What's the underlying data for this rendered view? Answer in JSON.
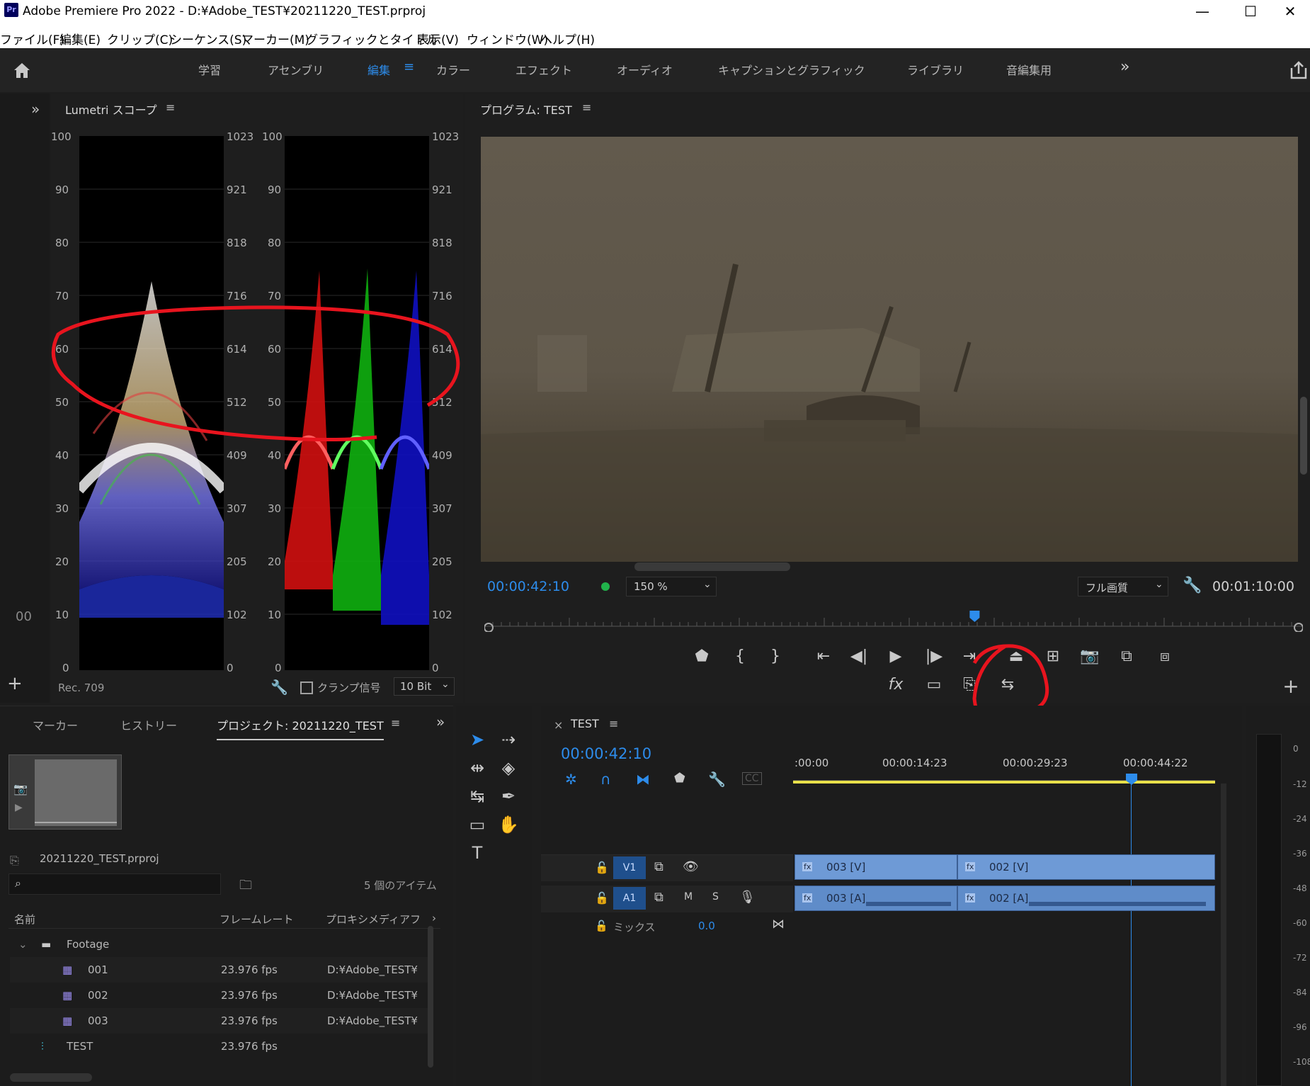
{
  "window": {
    "app_icon": "Pr",
    "title": "Adobe Premiere Pro 2022 - D:¥Adobe_TEST¥20211220_TEST.prproj",
    "minimize": "—",
    "maximize": "☐",
    "close": "✕"
  },
  "menu": [
    "ファイル(F)",
    "編集(E)",
    "クリップ(C)",
    "シーケンス(S)",
    "マーカー(M)",
    "グラフィックとタイトル",
    "表示(V)",
    "ウィンドウ(W)",
    "ヘルプ(H)"
  ],
  "workspaces": [
    "学習",
    "アセンブリ",
    "編集",
    "カラー",
    "エフェクト",
    "オーディオ",
    "キャプションとグラフィック",
    "ライブラリ",
    "音編集用"
  ],
  "workspace_active": "編集",
  "workspace_more": "»",
  "scope": {
    "title": "Lumetri スコープ",
    "left_scale": [
      "100",
      "90",
      "80",
      "70",
      "60",
      "50",
      "40",
      "30",
      "20",
      "10",
      "0"
    ],
    "right_scale": [
      "1023",
      "921",
      "818",
      "716",
      "614",
      "512",
      "409",
      "307",
      "205",
      "102",
      "0"
    ],
    "colorspace": "Rec. 709",
    "clamp_label": "クランプ信号",
    "bit_depth": "10 Bit",
    "side_label": "00"
  },
  "program": {
    "title": "プログラム: TEST",
    "timecode": "00:00:42:10",
    "zoom": "150 %",
    "quality": "フル画質",
    "duration": "00:01:10:00",
    "playhead_fraction": 0.6
  },
  "project": {
    "tabs": [
      "マーカー",
      "ヒストリー",
      "プロジェクト: 20211220_TEST"
    ],
    "active_tab": "プロジェクト: 20211220_TEST",
    "file": "20211220_TEST.prproj",
    "item_count": "5 個のアイテム",
    "columns": [
      "名前",
      "フレームレート",
      "プロキシメディアフ"
    ],
    "rows": [
      {
        "name": "Footage",
        "fps": "",
        "path": "",
        "type": "folder"
      },
      {
        "name": "001",
        "fps": "23.976 fps",
        "path": "D:¥Adobe_TEST¥",
        "type": "clip"
      },
      {
        "name": "002",
        "fps": "23.976 fps",
        "path": "D:¥Adobe_TEST¥",
        "type": "clip"
      },
      {
        "name": "003",
        "fps": "23.976 fps",
        "path": "D:¥Adobe_TEST¥",
        "type": "clip"
      },
      {
        "name": "TEST",
        "fps": "23.976 fps",
        "path": "",
        "type": "sequence"
      }
    ]
  },
  "timeline": {
    "title": "TEST",
    "close": "×",
    "timecode": "00:00:42:10",
    "ruler": [
      ":00:00",
      "00:00:14:23",
      "00:00:29:23",
      "00:00:44:22"
    ],
    "tracks": {
      "v1": "V1",
      "a1": "A1",
      "mute": "M",
      "solo": "S",
      "mix_label": "ミックス",
      "mix_value": "0.0"
    },
    "video_clips": [
      "003 [V]",
      "002 [V]"
    ],
    "audio_clips": [
      "003 [A]",
      "002 [A]"
    ],
    "fx_badge": "fx"
  },
  "meter_scale": [
    "0",
    "-12",
    "-24",
    "-36",
    "-48",
    "-60",
    "-72",
    "-84",
    "-96",
    "-108"
  ],
  "colors": {
    "accent": "#2d8ceb",
    "clip": "#6e9ad6",
    "annotation": "#e8141e",
    "work_area": "#e8e04a"
  }
}
